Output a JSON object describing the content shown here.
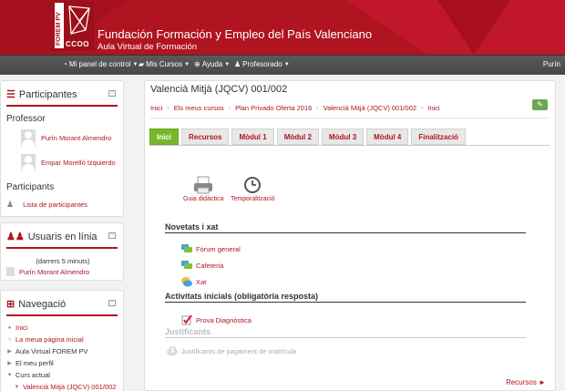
{
  "header": {
    "logo_vertical": "FOREM PV",
    "logo_bottom": "CCOO",
    "title": "Fundación Formación y Empleo del País Valenciano",
    "subtitle": "Aula Virtual de Formación",
    "brand_color": "#b01420"
  },
  "navbar": {
    "items": [
      {
        "label": "Mi panel de control",
        "icon": "dashboard-icon"
      },
      {
        "label": "Mis Cursos",
        "icon": "folder-icon"
      },
      {
        "label": "Ayuda",
        "icon": "help-icon"
      },
      {
        "label": "Profesorado",
        "icon": "users-icon"
      }
    ],
    "user": "Purín"
  },
  "participants": {
    "title": "Participantes",
    "professor_label": "Professor",
    "professors": [
      "Purín Morant Almendro",
      "Empar Morelló Izquierdo"
    ],
    "participants_label": "Participants",
    "list_link": "Lista de participantes"
  },
  "online": {
    "title": "Usuaris en línia",
    "note": "(darrers 5 minuts)",
    "users": [
      "Purín Morant Almendro"
    ]
  },
  "navigation": {
    "title": "Navegació",
    "items": [
      {
        "label": "Inici",
        "level": 0,
        "link": true
      },
      {
        "label": "La meua pàgina inicial",
        "level": 0,
        "link": true
      },
      {
        "label": "Aula Virtual FOREM PV",
        "level": 0,
        "link": false
      },
      {
        "label": "El meu perfil",
        "level": 0,
        "link": false
      },
      {
        "label": "Curs actual",
        "level": 0,
        "link": false
      },
      {
        "label": "Valencià Mitjà (JQCV) 001/002",
        "level": 1,
        "link": true
      }
    ]
  },
  "course": {
    "title": "Valencià Mitjà (JQCV) 001/002",
    "breadcrumb": [
      "Inici",
      "Els meus cursos",
      "Plan Privado Oferta 2016",
      "Valencià Mitjà (JQCV) 001/002",
      "Inici"
    ],
    "tabs": [
      "Inici",
      "Recursos",
      "Mòdul 1",
      "Mòdul 2",
      "Mòdul 3",
      "Mòdul 4",
      "Finalització"
    ],
    "active_tab": "Inici",
    "top_resources": [
      "Guia didàctica",
      "Temporalització"
    ],
    "sections": [
      {
        "title": "Novetats i xat",
        "activities": [
          "Fòrum general",
          "Cafeteria",
          "Xat"
        ]
      },
      {
        "title": "Activitats inicials (obligatòria resposta)",
        "activities": [
          "Prova Diagnòstica"
        ]
      },
      {
        "title": "Justificants",
        "activities": [
          "Justificants de pagament de matrícula"
        ]
      }
    ],
    "next_link": "Recursos ►"
  }
}
